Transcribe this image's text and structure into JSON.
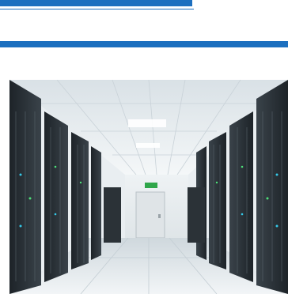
{
  "header": {
    "accent_color": "#1c6fbf"
  },
  "hero_image": {
    "subject": "server-room-photo",
    "exit_sign": "EXIT"
  }
}
